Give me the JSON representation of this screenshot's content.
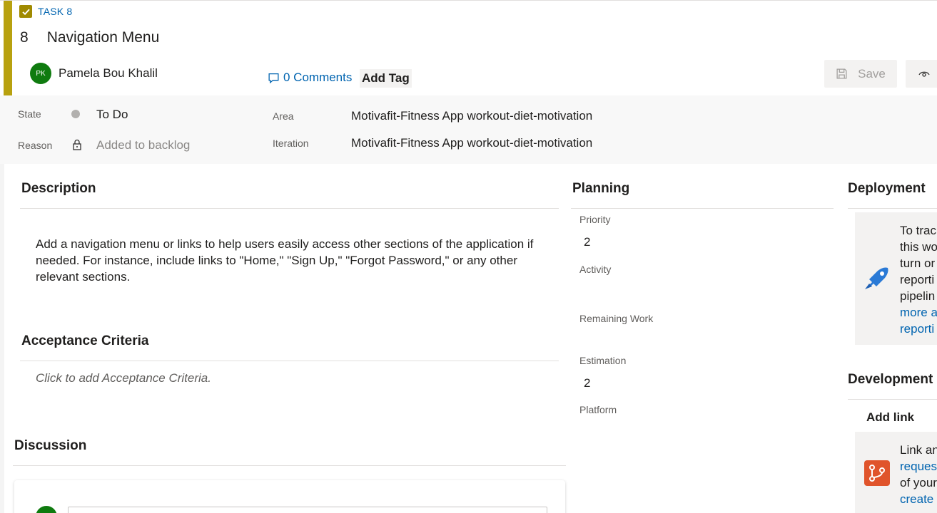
{
  "header": {
    "type_label": "TASK 8",
    "id": "8",
    "title": "Navigation Menu",
    "assignee": {
      "initials": "PK",
      "name": "Pamela Bou Khalil"
    },
    "comments": "0 Comments",
    "add_tag": "Add Tag",
    "save_label": "Save",
    "accent_color": "#b8a10f"
  },
  "fields": {
    "state_label": "State",
    "state_value": "To Do",
    "reason_label": "Reason",
    "reason_value": "Added to backlog",
    "area_label": "Area",
    "area_value": "Motivafit-Fitness App workout-diet-motivation",
    "iteration_label": "Iteration",
    "iteration_value": "Motivafit-Fitness App workout-diet-motivation"
  },
  "description": {
    "title": "Description",
    "text": "Add a navigation menu or links to help users easily access other sections of the application if needed. For instance, include links to \"Home,\" \"Sign Up,\" \"Forgot Password,\" or any other relevant sections."
  },
  "acceptance": {
    "title": "Acceptance Criteria",
    "placeholder": "Click to add Acceptance Criteria."
  },
  "discussion": {
    "title": "Discussion"
  },
  "planning": {
    "title": "Planning",
    "priority_label": "Priority",
    "priority_value": "2",
    "activity_label": "Activity",
    "remaining_label": "Remaining Work",
    "estimation_label": "Estimation",
    "estimation_value": "2",
    "platform_label": "Platform"
  },
  "deployment": {
    "title": "Deployment",
    "lines": [
      "To trac",
      "this wo",
      "turn or",
      "reporti",
      "pipelin"
    ],
    "link_lines": [
      "more a",
      "reporti"
    ]
  },
  "development": {
    "title": "Development",
    "add_link": "Add link",
    "line1": "Link an",
    "link1": "reques",
    "line2": "of your",
    "link2": "create"
  }
}
